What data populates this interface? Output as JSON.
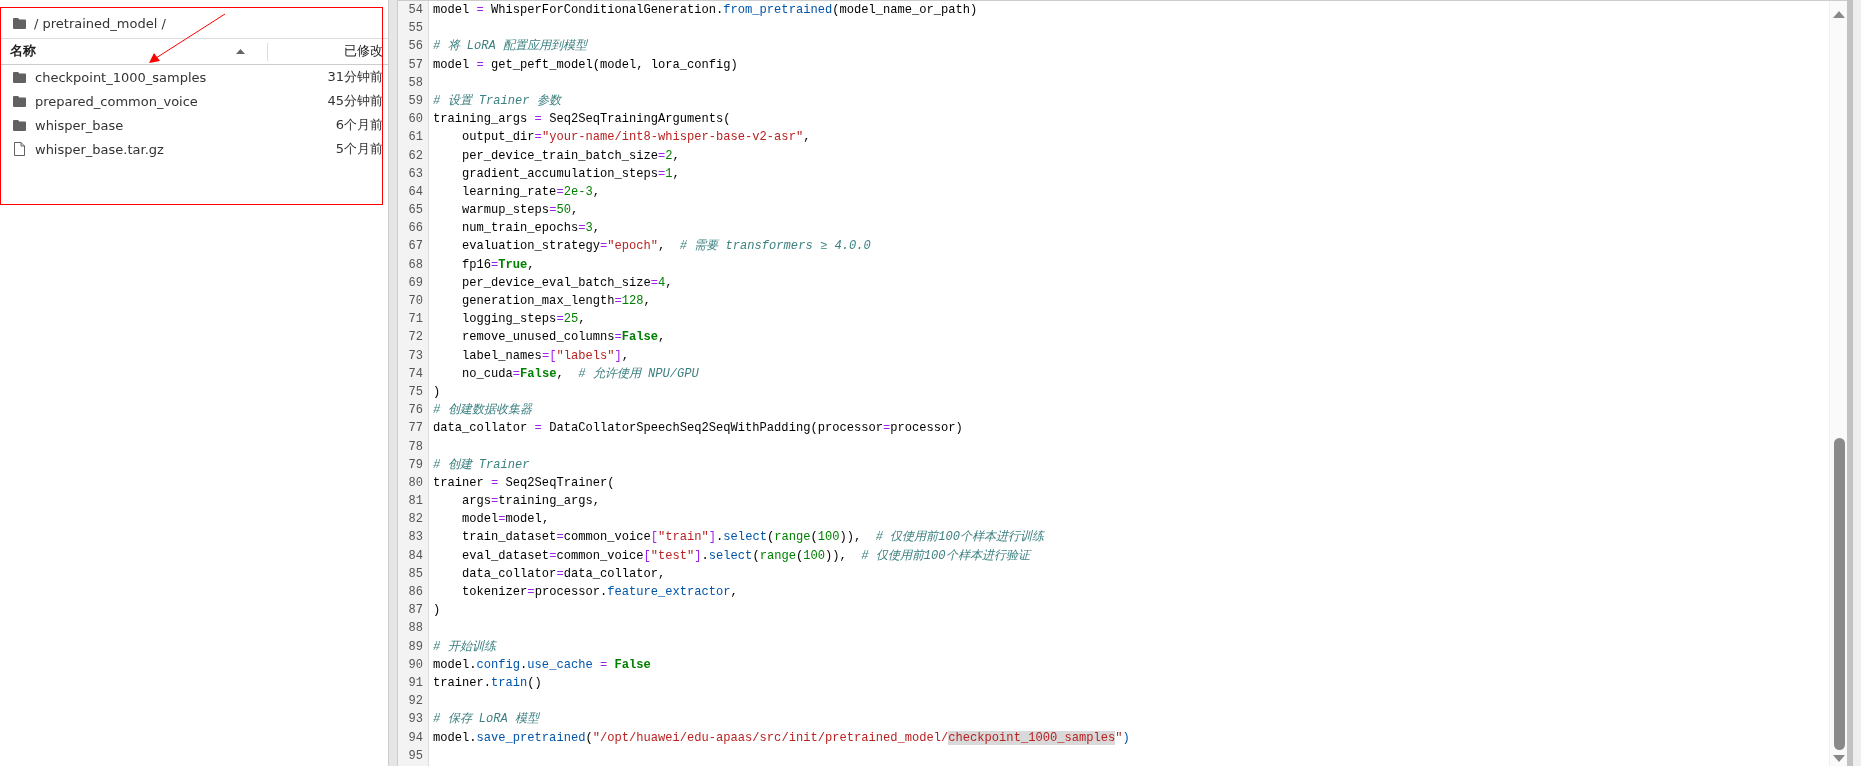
{
  "file_browser": {
    "path": "/ pretrained_model /",
    "columns": [
      "名称",
      "已修改"
    ],
    "items": [
      {
        "kind": "folder",
        "name": "checkpoint_1000_samples",
        "modified": "31分钟前"
      },
      {
        "kind": "folder",
        "name": "prepared_common_voice",
        "modified": "45分钟前"
      },
      {
        "kind": "folder",
        "name": "whisper_base",
        "modified": "6个月前"
      },
      {
        "kind": "file",
        "name": "whisper_base.tar.gz",
        "modified": "5个月前"
      }
    ]
  },
  "editor": {
    "lines": [
      {
        "number": "54",
        "tokens": [
          {
            "kind": "plain",
            "text": "model "
          },
          {
            "kind": "op",
            "text": "="
          },
          {
            "kind": "plain",
            "text": " WhisperForConditionalGeneration."
          },
          {
            "kind": "attr",
            "text": "from_pretrained"
          },
          {
            "kind": "plain",
            "text": "(model_name_or_path)"
          }
        ]
      },
      {
        "number": "55"
      },
      {
        "number": "56",
        "tokens": [
          {
            "kind": "comment",
            "text": "# 将 LoRA 配置应用到模型"
          }
        ]
      },
      {
        "number": "57",
        "tokens": [
          {
            "kind": "plain",
            "text": "model "
          },
          {
            "kind": "op",
            "text": "="
          },
          {
            "kind": "plain",
            "text": " get_peft_model(model, lora_config)"
          }
        ]
      },
      {
        "number": "58"
      },
      {
        "number": "59",
        "tokens": [
          {
            "kind": "comment",
            "text": "# 设置 Trainer 参数"
          }
        ]
      },
      {
        "number": "60",
        "tokens": [
          {
            "kind": "plain",
            "text": "training_args "
          },
          {
            "kind": "op",
            "text": "="
          },
          {
            "kind": "plain",
            "text": " Seq2SeqTrainingArguments("
          }
        ]
      },
      {
        "number": "61",
        "tokens": [
          {
            "kind": "plain",
            "text": "    output_dir"
          },
          {
            "kind": "op",
            "text": "="
          },
          {
            "kind": "str",
            "text": "\"your-name/int8-whisper-base-v2-asr\""
          },
          {
            "kind": "plain",
            "text": ","
          }
        ]
      },
      {
        "number": "62",
        "tokens": [
          {
            "kind": "plain",
            "text": "    per_device_train_batch_size"
          },
          {
            "kind": "op",
            "text": "="
          },
          {
            "kind": "num",
            "text": "2"
          },
          {
            "kind": "plain",
            "text": ","
          }
        ]
      },
      {
        "number": "63",
        "tokens": [
          {
            "kind": "plain",
            "text": "    gradient_accumulation_steps"
          },
          {
            "kind": "op",
            "text": "="
          },
          {
            "kind": "num",
            "text": "1"
          },
          {
            "kind": "plain",
            "text": ","
          }
        ]
      },
      {
        "number": "64",
        "tokens": [
          {
            "kind": "plain",
            "text": "    learning_rate"
          },
          {
            "kind": "op",
            "text": "="
          },
          {
            "kind": "num",
            "text": "2e-3"
          },
          {
            "kind": "plain",
            "text": ","
          }
        ]
      },
      {
        "number": "65",
        "tokens": [
          {
            "kind": "plain",
            "text": "    warmup_steps"
          },
          {
            "kind": "op",
            "text": "="
          },
          {
            "kind": "num",
            "text": "50"
          },
          {
            "kind": "plain",
            "text": ","
          }
        ]
      },
      {
        "number": "66",
        "tokens": [
          {
            "kind": "plain",
            "text": "    num_train_epochs"
          },
          {
            "kind": "op",
            "text": "="
          },
          {
            "kind": "num",
            "text": "3"
          },
          {
            "kind": "plain",
            "text": ","
          }
        ]
      },
      {
        "number": "67",
        "tokens": [
          {
            "kind": "plain",
            "text": "    evaluation_strategy"
          },
          {
            "kind": "op",
            "text": "="
          },
          {
            "kind": "str",
            "text": "\"epoch\""
          },
          {
            "kind": "plain",
            "text": ",  "
          },
          {
            "kind": "comment",
            "text": "# 需要 transformers ≥ 4.0.0"
          }
        ]
      },
      {
        "number": "68",
        "tokens": [
          {
            "kind": "plain",
            "text": "    fp16"
          },
          {
            "kind": "op",
            "text": "="
          },
          {
            "kind": "kw",
            "text": "True"
          },
          {
            "kind": "plain",
            "text": ","
          }
        ]
      },
      {
        "number": "69",
        "tokens": [
          {
            "kind": "plain",
            "text": "    per_device_eval_batch_size"
          },
          {
            "kind": "op",
            "text": "="
          },
          {
            "kind": "num",
            "text": "4"
          },
          {
            "kind": "plain",
            "text": ","
          }
        ]
      },
      {
        "number": "70",
        "tokens": [
          {
            "kind": "plain",
            "text": "    generation_max_length"
          },
          {
            "kind": "op",
            "text": "="
          },
          {
            "kind": "num",
            "text": "128"
          },
          {
            "kind": "plain",
            "text": ","
          }
        ]
      },
      {
        "number": "71",
        "tokens": [
          {
            "kind": "plain",
            "text": "    logging_steps"
          },
          {
            "kind": "op",
            "text": "="
          },
          {
            "kind": "num",
            "text": "25"
          },
          {
            "kind": "plain",
            "text": ","
          }
        ]
      },
      {
        "number": "72",
        "tokens": [
          {
            "kind": "plain",
            "text": "    remove_unused_columns"
          },
          {
            "kind": "op",
            "text": "="
          },
          {
            "kind": "kw",
            "text": "False"
          },
          {
            "kind": "plain",
            "text": ","
          }
        ]
      },
      {
        "number": "73",
        "tokens": [
          {
            "kind": "plain",
            "text": "    label_names"
          },
          {
            "kind": "op",
            "text": "=["
          },
          {
            "kind": "str",
            "text": "\"labels\""
          },
          {
            "kind": "op",
            "text": "]"
          },
          {
            "kind": "plain",
            "text": ","
          }
        ]
      },
      {
        "number": "74",
        "tokens": [
          {
            "kind": "plain",
            "text": "    no_cuda"
          },
          {
            "kind": "op",
            "text": "="
          },
          {
            "kind": "kw",
            "text": "False"
          },
          {
            "kind": "plain",
            "text": ",  "
          },
          {
            "kind": "comment",
            "text": "# 允许使用 NPU/GPU"
          }
        ]
      },
      {
        "number": "75",
        "tokens": [
          {
            "kind": "plain",
            "text": ")"
          }
        ]
      },
      {
        "number": "76",
        "tokens": [
          {
            "kind": "comment",
            "text": "# 创建数据收集器"
          }
        ]
      },
      {
        "number": "77",
        "tokens": [
          {
            "kind": "plain",
            "text": "data_collator "
          },
          {
            "kind": "op",
            "text": "="
          },
          {
            "kind": "plain",
            "text": " DataCollatorSpeechSeq2SeqWithPadding(processor"
          },
          {
            "kind": "op",
            "text": "="
          },
          {
            "kind": "plain",
            "text": "processor)"
          }
        ]
      },
      {
        "number": "78"
      },
      {
        "number": "79",
        "tokens": [
          {
            "kind": "comment",
            "text": "# 创建 Trainer"
          }
        ]
      },
      {
        "number": "80",
        "tokens": [
          {
            "kind": "plain",
            "text": "trainer "
          },
          {
            "kind": "op",
            "text": "="
          },
          {
            "kind": "plain",
            "text": " Seq2SeqTrainer("
          }
        ]
      },
      {
        "number": "81",
        "tokens": [
          {
            "kind": "plain",
            "text": "    args"
          },
          {
            "kind": "op",
            "text": "="
          },
          {
            "kind": "plain",
            "text": "training_args,"
          }
        ]
      },
      {
        "number": "82",
        "tokens": [
          {
            "kind": "plain",
            "text": "    model"
          },
          {
            "kind": "op",
            "text": "="
          },
          {
            "kind": "plain",
            "text": "model,"
          }
        ]
      },
      {
        "number": "83",
        "tokens": [
          {
            "kind": "plain",
            "text": "    train_dataset"
          },
          {
            "kind": "op",
            "text": "="
          },
          {
            "kind": "plain",
            "text": "common_voice"
          },
          {
            "kind": "op",
            "text": "["
          },
          {
            "kind": "str",
            "text": "\"train\""
          },
          {
            "kind": "op",
            "text": "]"
          },
          {
            "kind": "plain",
            "text": "."
          },
          {
            "kind": "attr",
            "text": "select"
          },
          {
            "kind": "plain",
            "text": "("
          },
          {
            "kind": "builtin",
            "text": "range"
          },
          {
            "kind": "plain",
            "text": "("
          },
          {
            "kind": "num",
            "text": "100"
          },
          {
            "kind": "plain",
            "text": ")),  "
          },
          {
            "kind": "comment",
            "text": "# 仅使用前100个样本进行训练"
          }
        ]
      },
      {
        "number": "84",
        "tokens": [
          {
            "kind": "plain",
            "text": "    eval_dataset"
          },
          {
            "kind": "op",
            "text": "="
          },
          {
            "kind": "plain",
            "text": "common_voice"
          },
          {
            "kind": "op",
            "text": "["
          },
          {
            "kind": "str",
            "text": "\"test\""
          },
          {
            "kind": "op",
            "text": "]"
          },
          {
            "kind": "plain",
            "text": "."
          },
          {
            "kind": "attr",
            "text": "select"
          },
          {
            "kind": "plain",
            "text": "("
          },
          {
            "kind": "builtin",
            "text": "range"
          },
          {
            "kind": "plain",
            "text": "("
          },
          {
            "kind": "num",
            "text": "100"
          },
          {
            "kind": "plain",
            "text": ")),  "
          },
          {
            "kind": "comment",
            "text": "# 仅使用前100个样本进行验证"
          }
        ]
      },
      {
        "number": "85",
        "tokens": [
          {
            "kind": "plain",
            "text": "    data_collator"
          },
          {
            "kind": "op",
            "text": "="
          },
          {
            "kind": "plain",
            "text": "data_collator,"
          }
        ]
      },
      {
        "number": "86",
        "tokens": [
          {
            "kind": "plain",
            "text": "    tokenizer"
          },
          {
            "kind": "op",
            "text": "="
          },
          {
            "kind": "plain",
            "text": "processor."
          },
          {
            "kind": "attr",
            "text": "feature_extractor"
          },
          {
            "kind": "plain",
            "text": ","
          }
        ]
      },
      {
        "number": "87",
        "tokens": [
          {
            "kind": "plain",
            "text": ")"
          }
        ]
      },
      {
        "number": "88"
      },
      {
        "number": "89",
        "tokens": [
          {
            "kind": "comment",
            "text": "# 开始训练"
          }
        ]
      },
      {
        "number": "90",
        "tokens": [
          {
            "kind": "plain",
            "text": "model."
          },
          {
            "kind": "attr",
            "text": "config"
          },
          {
            "kind": "plain",
            "text": "."
          },
          {
            "kind": "attr",
            "text": "use_cache"
          },
          {
            "kind": "op",
            "text": " = "
          },
          {
            "kind": "kw",
            "text": "False"
          }
        ]
      },
      {
        "number": "91",
        "tokens": [
          {
            "kind": "plain",
            "text": "trainer."
          },
          {
            "kind": "attr",
            "text": "train"
          },
          {
            "kind": "plain",
            "text": "()"
          }
        ]
      },
      {
        "number": "92"
      },
      {
        "number": "93",
        "tokens": [
          {
            "kind": "comment",
            "text": "# 保存 LoRA 模型"
          }
        ]
      },
      {
        "number": "94",
        "tokens": [
          {
            "kind": "plain",
            "text": "model."
          },
          {
            "kind": "attr",
            "text": "save_pretrained"
          },
          {
            "kind": "plain",
            "text": "("
          },
          {
            "kind": "str",
            "text": "\"/opt/huawei/edu-apaas/src/init/pretrained_model/"
          },
          {
            "kind": "selected",
            "text": "checkpoint_1000_samples"
          },
          {
            "kind": "str",
            "text": "\""
          },
          {
            "kind": "attr",
            "text": ")"
          }
        ]
      },
      {
        "number": "95"
      }
    ]
  }
}
